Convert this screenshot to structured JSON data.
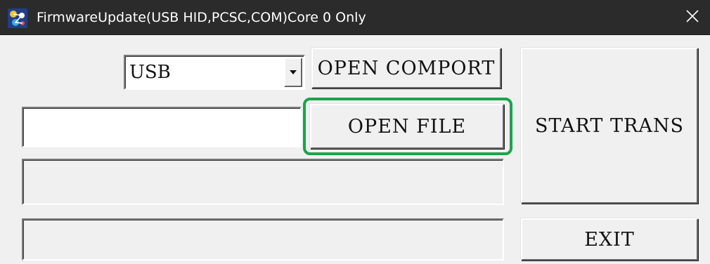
{
  "window": {
    "title": "FirmwareUpdate(USB HID,PCSC,COM)Core 0 Only",
    "app_icon": "app-icon",
    "close_icon": "close-icon",
    "close_glyph": "✕"
  },
  "controls": {
    "port_select": {
      "value": "USB",
      "arrow_icon": "dropdown-arrow-icon"
    },
    "open_comport_label": "OPEN COMPORT",
    "file_path": {
      "value": "",
      "placeholder": ""
    },
    "open_file_label": "OPEN FILE",
    "start_trans_label": "START TRANS",
    "exit_label": "EXIT",
    "status_line_1": "",
    "status_line_2": ""
  },
  "colors": {
    "titlebar": "#2b2b2b",
    "window_bg": "#f0f0f0",
    "highlight": "#1aa54a"
  }
}
